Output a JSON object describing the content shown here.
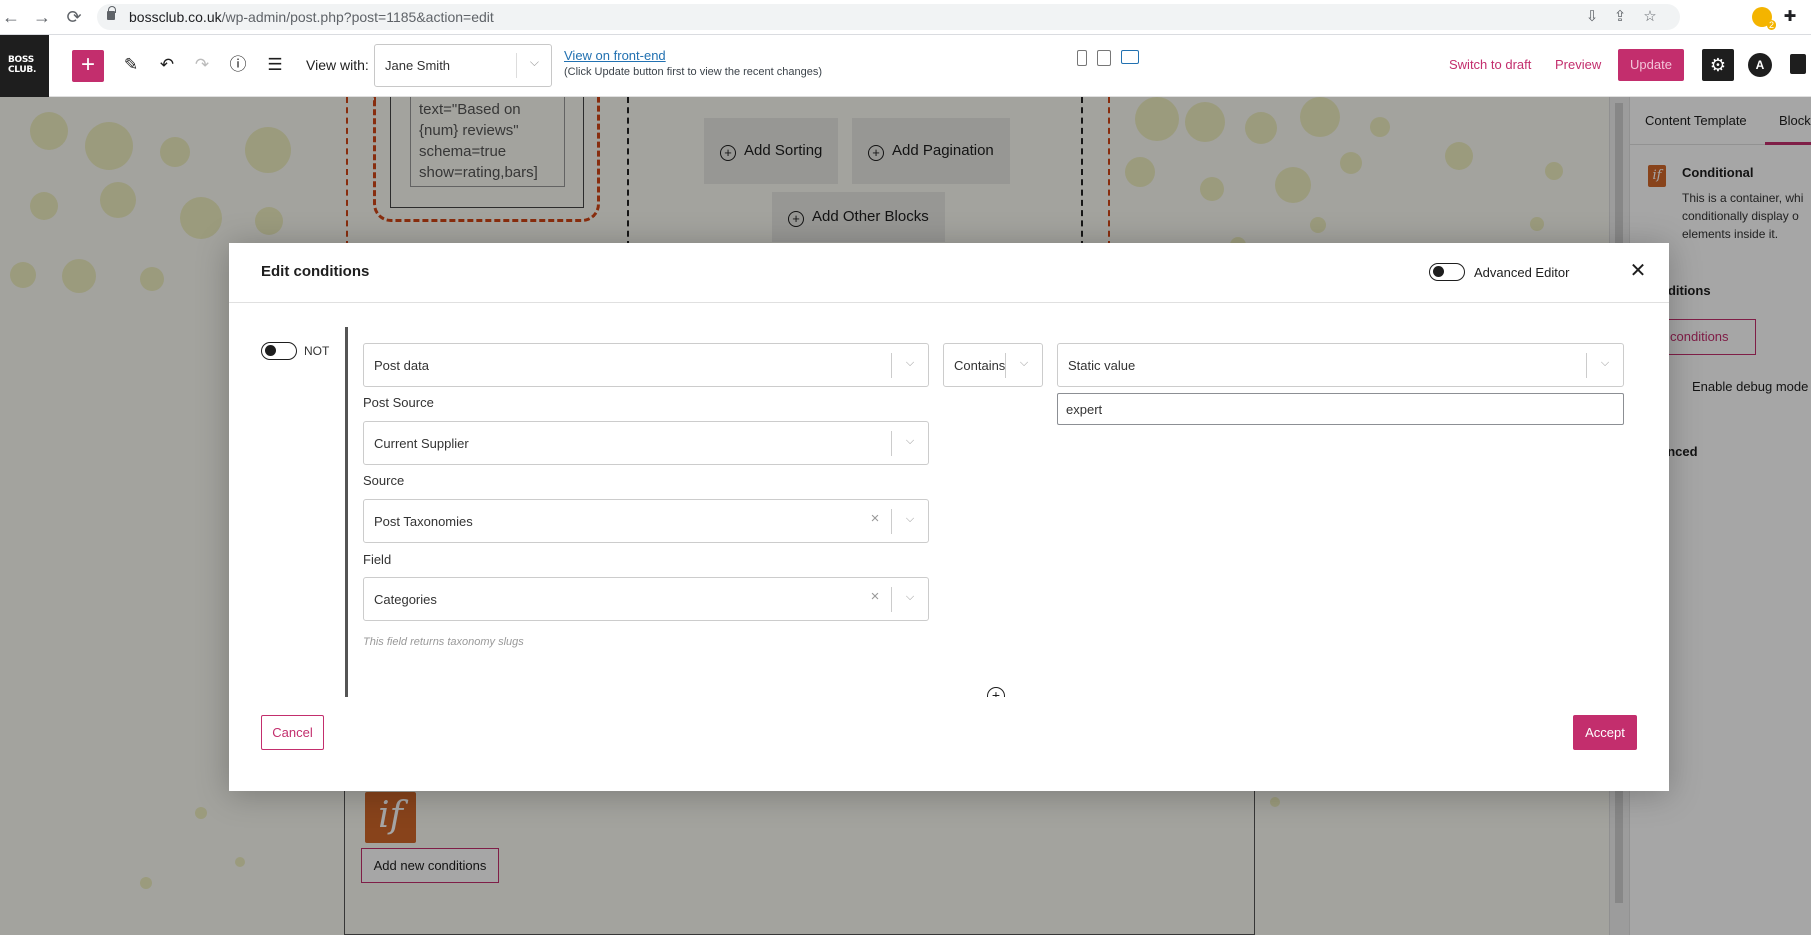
{
  "browser": {
    "url_host": "bossclub.co.uk",
    "url_path": "/wp-admin/post.php?post=1185&action=edit",
    "extension_badge": "2"
  },
  "toolbar": {
    "site_logo": "BOSS CLUB.",
    "inserter_label": "+",
    "view_with_label": "View with:",
    "view_with_value": "Jane Smith",
    "frontend_link": "View on front-end",
    "frontend_note": "(Click Update button first to view the recent changes)",
    "switch_to_draft": "Switch to draft",
    "preview": "Preview",
    "update": "Update"
  },
  "canvas": {
    "reviews_code": [
      "text=\"Based on",
      "{num} reviews\"",
      "schema=true",
      "show=rating,bars]"
    ],
    "add_sorting": "Add Sorting",
    "add_pagination": "Add Pagination",
    "add_other_blocks": "Add Other Blocks",
    "if_icon": "if",
    "add_new_conditions": "Add new conditions"
  },
  "sidebar": {
    "tabs": [
      "Content Template",
      "Block"
    ],
    "active_tab": "Block",
    "block_title": "Conditional",
    "block_desc": [
      "This is a container, whi",
      "conditionally display o",
      "elements inside it."
    ],
    "section_conditions": "nditions",
    "edit_conditions_button": "lit conditions",
    "debug_label": "Enable debug mode",
    "section_advanced": "anced"
  },
  "modal": {
    "title": "Edit conditions",
    "advanced_editor_label": "Advanced Editor",
    "advanced_editor_on": false,
    "not_label": "NOT",
    "not_on": false,
    "condition_type": "Post data",
    "operator": "Contains",
    "compare_type": "Static value",
    "compare_value": "expert",
    "post_source_label": "Post Source",
    "post_source": "Current Supplier",
    "source_label": "Source",
    "source": "Post Taxonomies",
    "field_label": "Field",
    "field": "Categories",
    "field_help": "This field returns taxonomy slugs",
    "cancel": "Cancel",
    "accept": "Accept"
  },
  "colors": {
    "accent": "#c32e6d",
    "conditional_icon": "#d2672a",
    "link": "#2271b1"
  }
}
